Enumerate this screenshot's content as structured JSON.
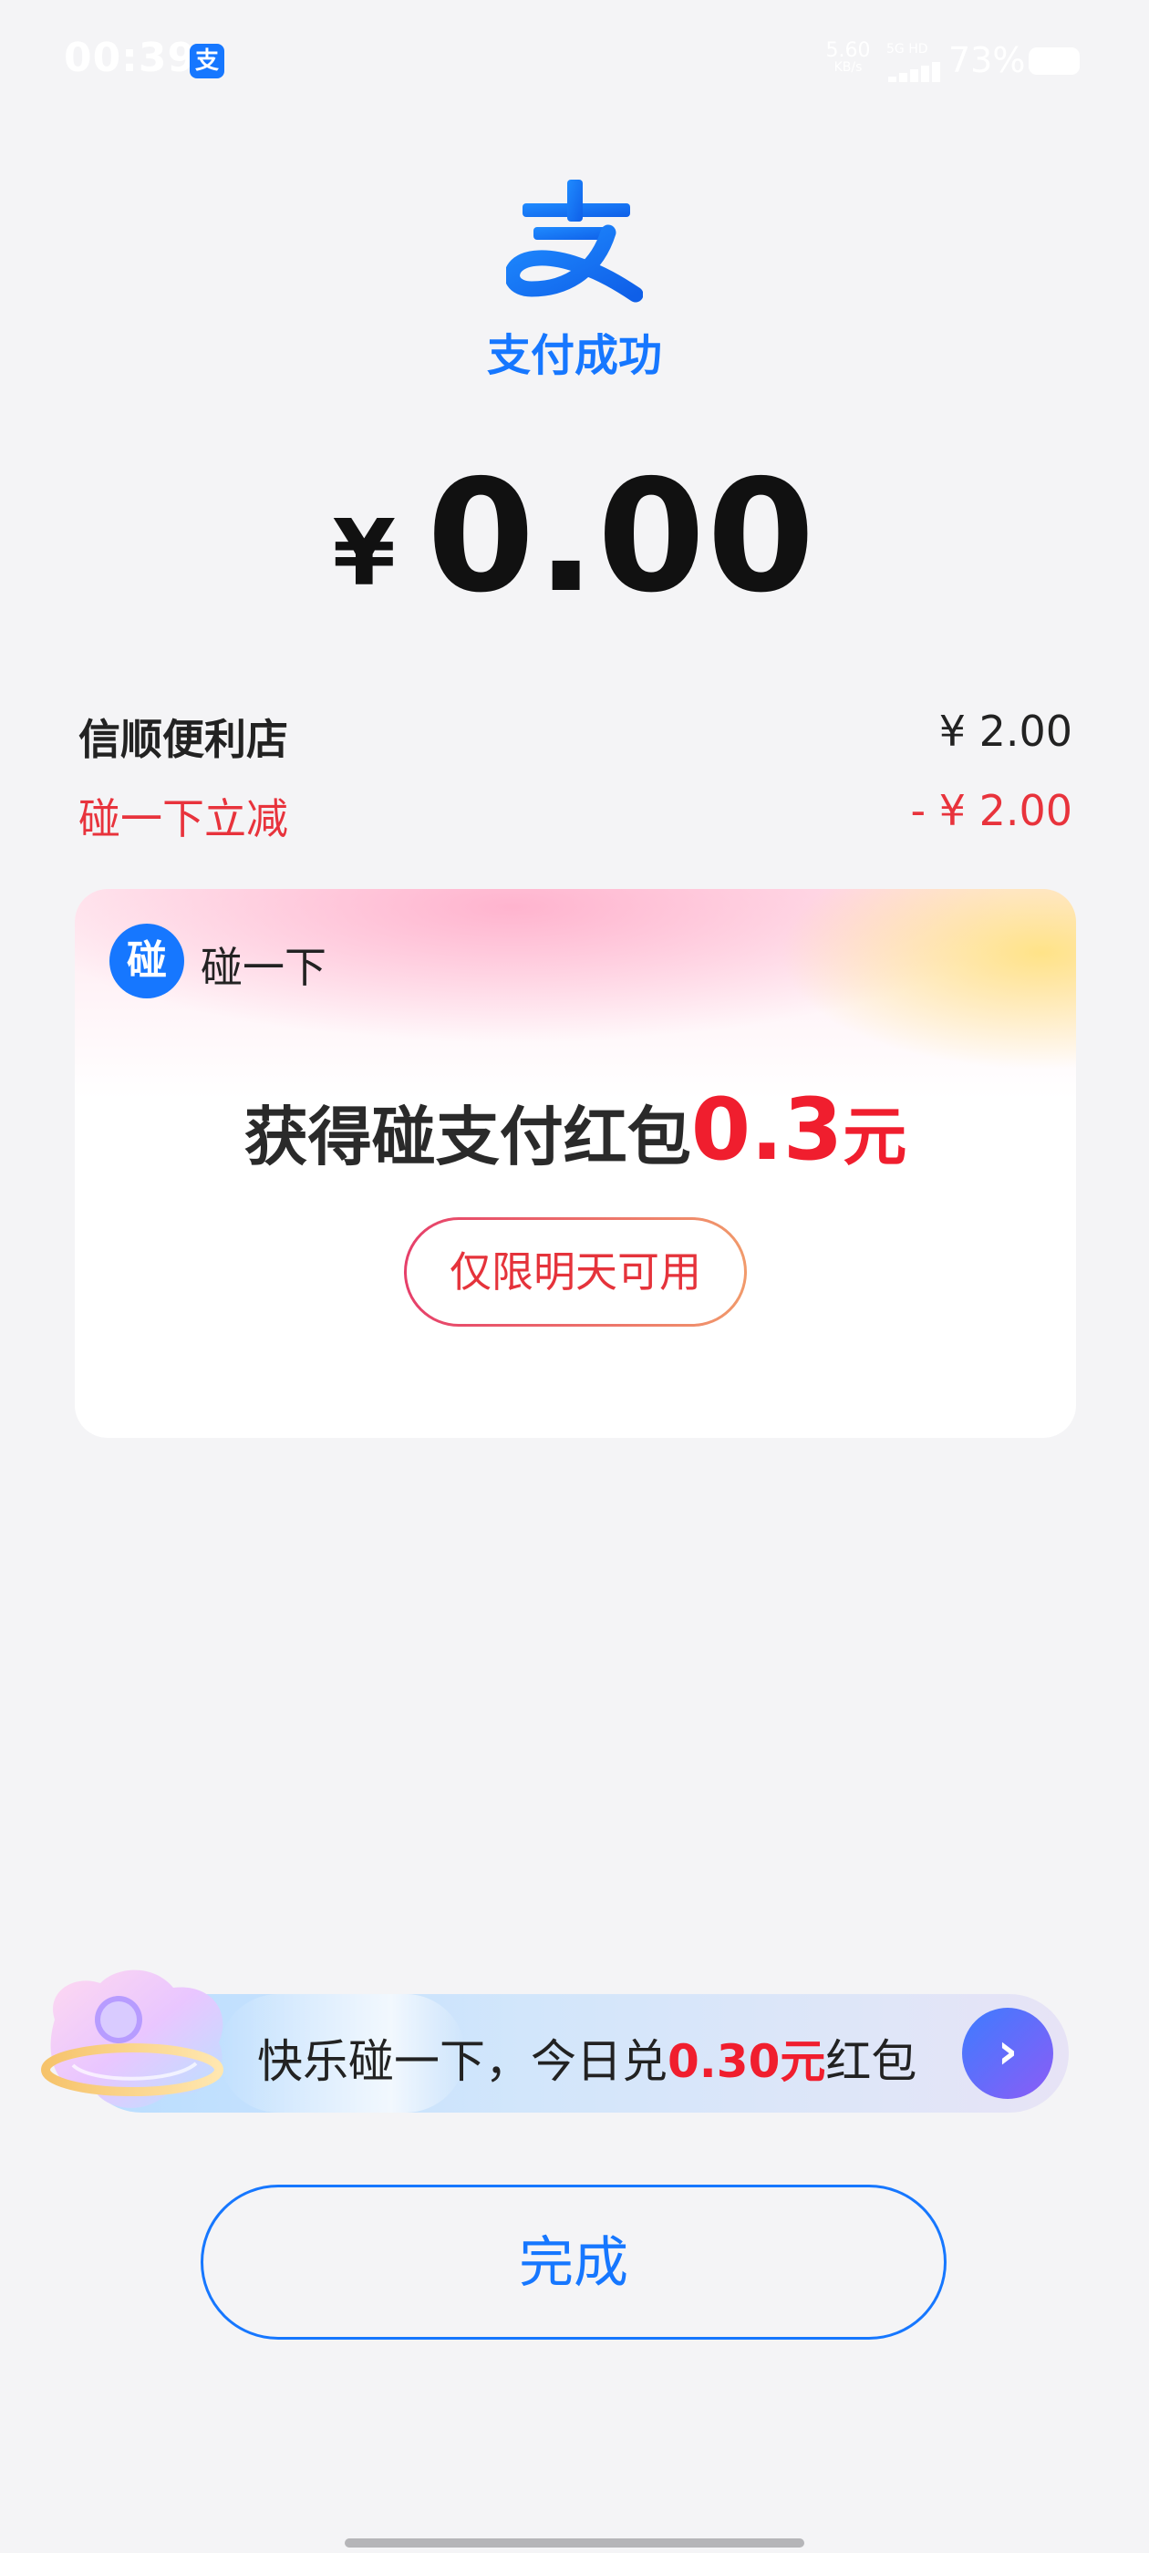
{
  "status_bar": {
    "time": "00:39",
    "app_badge": "支",
    "network_speed": "5.60",
    "network_unit": "KB/s",
    "network_type": "5G HD",
    "battery_percent": "73%"
  },
  "header": {
    "logo_icon": "alipay-logo-icon",
    "title": "支付成功",
    "currency_symbol": "¥",
    "amount": "0.00"
  },
  "details": {
    "merchant_name": "信顺便利店",
    "merchant_amount": "¥ 2.00",
    "discount_label": "碰一下立减",
    "discount_amount": "- ¥ 2.00"
  },
  "reward_card": {
    "brand_icon": "碰",
    "brand_name": "碰一下",
    "headline_text": "获得碰支付红包",
    "headline_amount": "0.3",
    "headline_unit": "元",
    "validity": "仅限明天可用"
  },
  "promo_banner": {
    "text_prefix": "快乐碰一下，今日兑",
    "text_highlight": "0.30元",
    "text_suffix": "红包",
    "arrow_icon": "chevron-right-icon"
  },
  "done_button_label": "完成",
  "colors": {
    "primary_blue": "#1677ff",
    "discount_red": "#e8333c",
    "highlight_red": "#f01e2e",
    "background": "#f4f4f6"
  }
}
